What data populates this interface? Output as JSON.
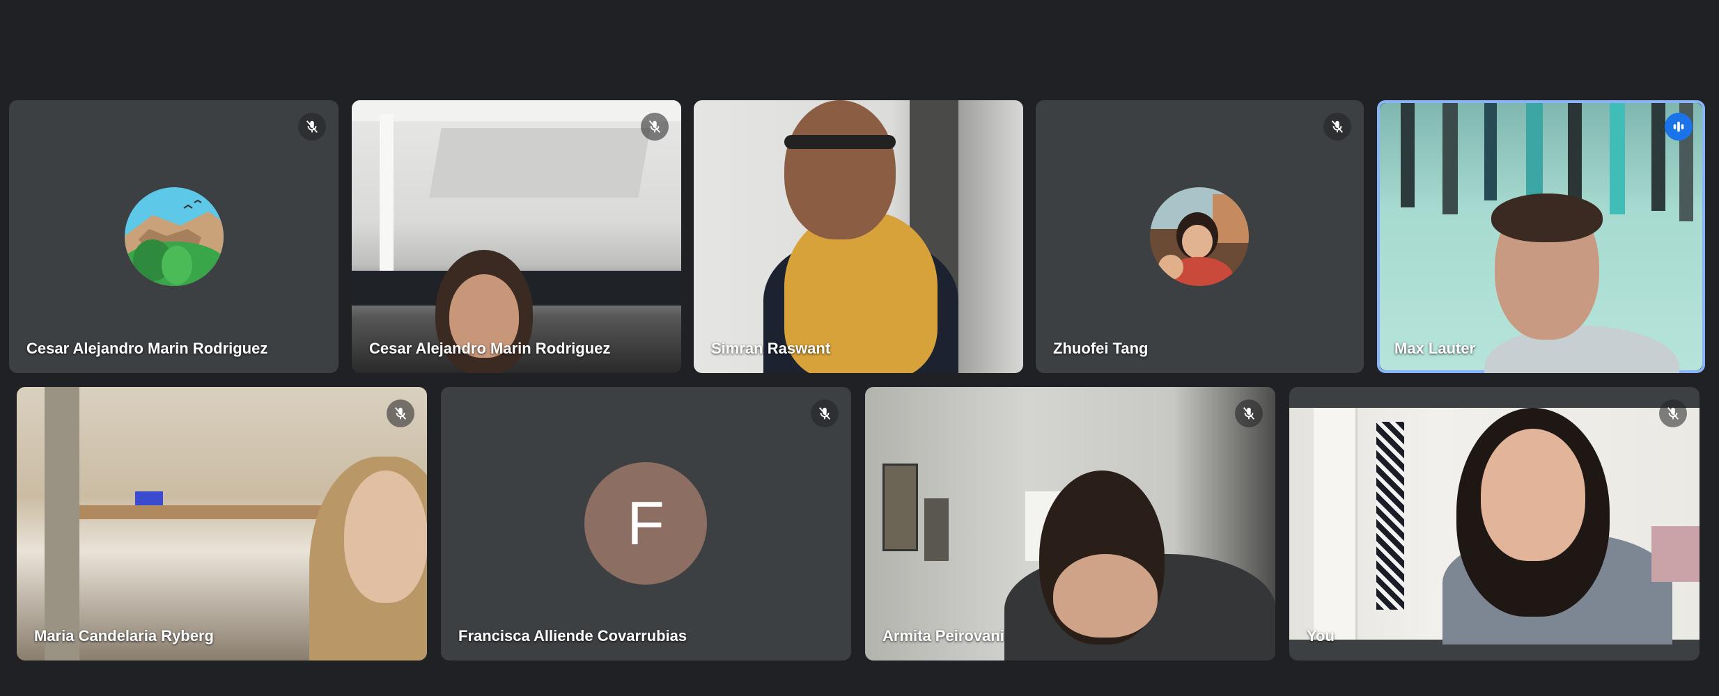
{
  "participants": [
    {
      "name": "Cesar Alejandro Marin Rodriguez",
      "muted": true,
      "camera": "off",
      "avatar": "landscape-profile-photo"
    },
    {
      "name": "Cesar Alejandro Marin Rodriguez",
      "muted": true,
      "camera": "on"
    },
    {
      "name": "Simran Raswant",
      "muted": false,
      "camera": "on"
    },
    {
      "name": "Zhuofei Tang",
      "muted": true,
      "camera": "off",
      "avatar": "profile-photo"
    },
    {
      "name": "Max Lauter",
      "muted": false,
      "speaking": true,
      "camera": "on"
    },
    {
      "name": "Maria Candelaria Ryberg",
      "muted": true,
      "camera": "on"
    },
    {
      "name": "Francisca Alliende Covarrubias",
      "muted": true,
      "camera": "off",
      "initial": "F"
    },
    {
      "name": "Armita Peirovani",
      "muted": true,
      "camera": "on"
    },
    {
      "name": "You",
      "muted": true,
      "camera": "on"
    }
  ],
  "colors": {
    "background": "#202124",
    "tile": "#3c4043",
    "speaking_border": "#8ab4f8",
    "speaking_indicator": "#1a73e8",
    "initial_avatar": "#8d6e63"
  },
  "icons": {
    "muted": "mic-off-icon",
    "speaking": "audio-level-icon"
  }
}
